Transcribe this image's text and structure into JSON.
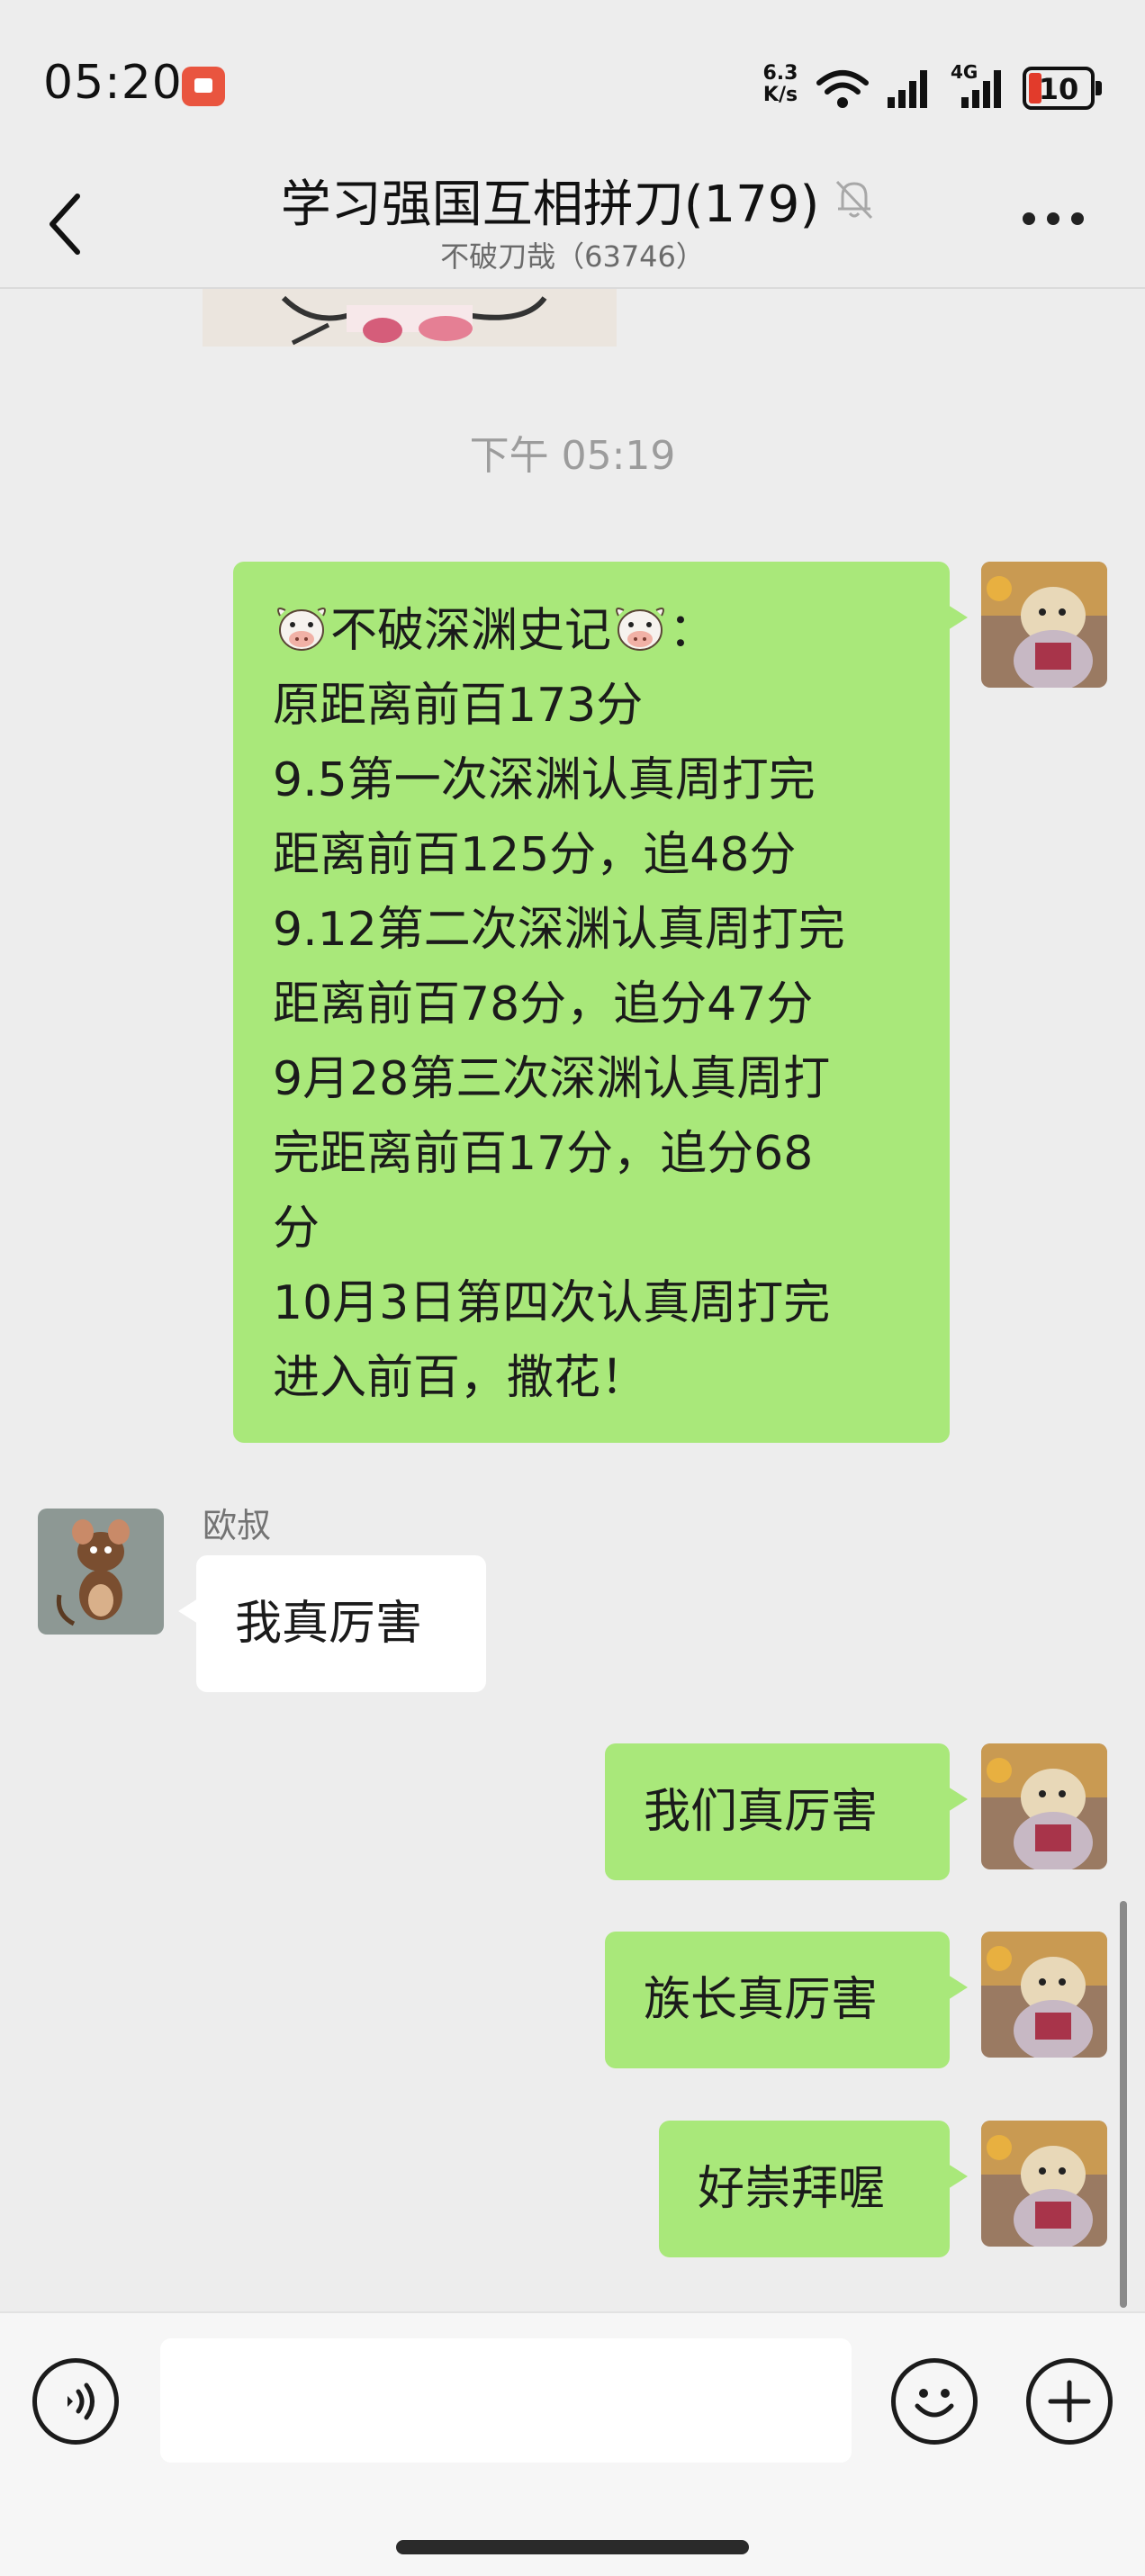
{
  "status_bar": {
    "time": "05:20",
    "net_speed_value": "6.3",
    "net_speed_unit": "K/s",
    "network_type": "4G",
    "battery": "10"
  },
  "header": {
    "title": "学习强国互相拼刀(179)",
    "subtitle": "不破刀哉（63746）"
  },
  "messages": {
    "timestamp": "下午 05:19",
    "history": {
      "title": "不破深渊史记",
      "title_suffix": "：",
      "lines": [
        "原距离前百173分",
        "9.5第一次深渊认真周打完",
        "距离前百125分，追48分",
        "9.12第二次深渊认真周打完",
        "距离前百78分，追分47分",
        "9月28第三次深渊认真周打",
        "完距离前百17分，追分68",
        "分",
        "10月3日第四次认真周打完",
        "进入前百，撒花！"
      ]
    },
    "incoming": {
      "sender": "欧叔",
      "text": "我真厉害"
    },
    "outgoing_1": "我们真厉害",
    "outgoing_2": "族长真厉害",
    "outgoing_3": "好崇拜喔"
  },
  "input_bar": {
    "message_value": ""
  },
  "icons": {
    "status": [
      "screen-record-icon",
      "wifi-icon",
      "signal-icon",
      "battery-icon"
    ],
    "header": [
      "back-icon",
      "mute-bell-icon",
      "more-icon"
    ],
    "message": [
      "cow-emoji-icon"
    ],
    "input": [
      "voice-icon",
      "emoji-icon",
      "add-icon"
    ]
  },
  "colors": {
    "background": "#ededed",
    "outgoing_bubble": "#a9e87a",
    "incoming_bubble": "#ffffff",
    "timestamp": "#9c9c9c"
  }
}
